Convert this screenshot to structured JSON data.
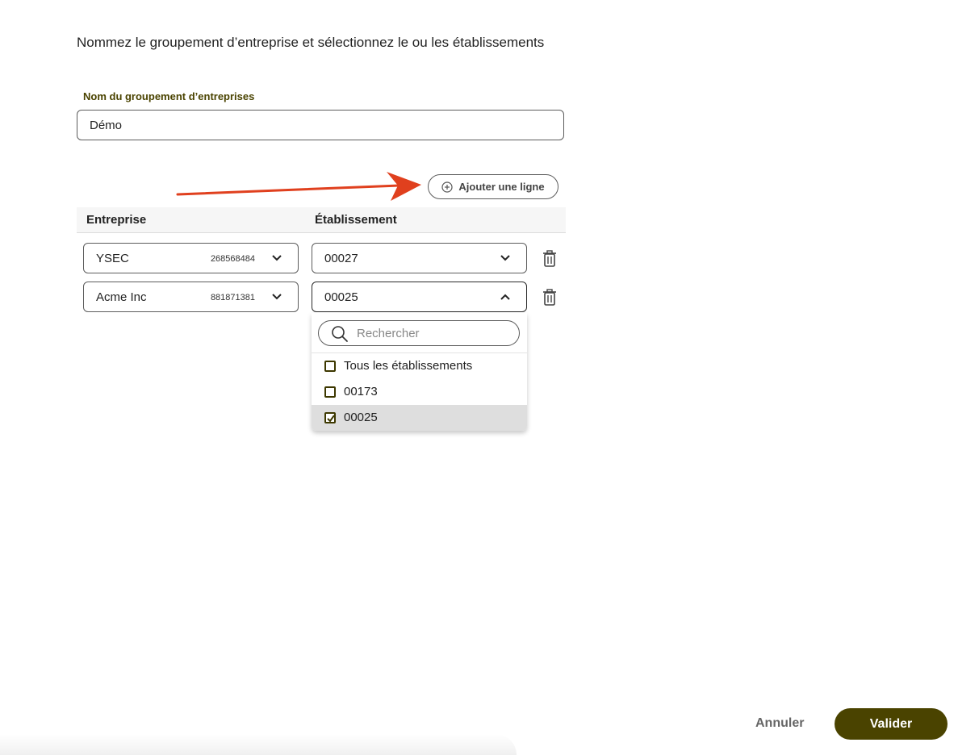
{
  "intro": "Nommez le groupement d’entreprise et sélectionnez le ou les établissements",
  "group_name": {
    "label": "Nom du groupement d’entreprises",
    "value": "Démo"
  },
  "add_line_button": {
    "label": "Ajouter une ligne",
    "icon": "plus-circle-icon"
  },
  "annotation": {
    "type": "arrow",
    "color": "#e0401e"
  },
  "table": {
    "headers": {
      "company": "Entreprise",
      "establishment": "Établissement"
    },
    "rows": [
      {
        "company": "YSEC",
        "siren": "268568484",
        "establishment": "00027",
        "expanded": false
      },
      {
        "company": "Acme Inc",
        "siren": "881871381",
        "establishment": "00025",
        "expanded": true
      }
    ]
  },
  "dropdown": {
    "search_placeholder": "Rechercher",
    "options": [
      {
        "label": "Tous les établissements",
        "checked": false
      },
      {
        "label": "00173",
        "checked": false
      },
      {
        "label": "00025",
        "checked": true
      }
    ]
  },
  "footer": {
    "cancel_label": "Annuler",
    "submit_label": "Valider"
  },
  "colors": {
    "brand": "#4a4300",
    "label": "#4a4300",
    "annotation_arrow": "#e0401e",
    "selected_option_bg": "#dedede"
  }
}
